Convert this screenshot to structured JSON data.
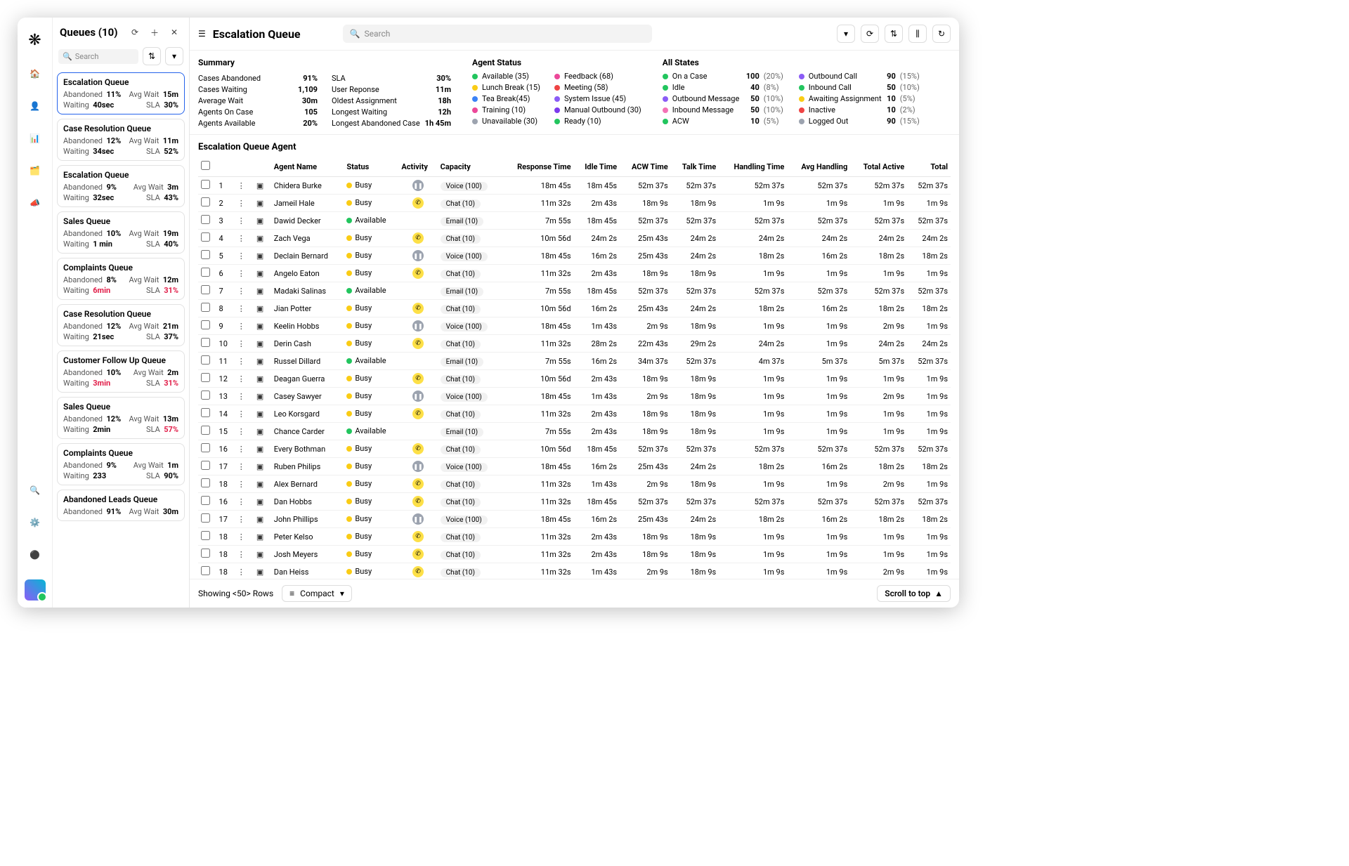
{
  "sidebar": {
    "title": "Queues (10)",
    "search_placeholder": "Search",
    "queues": [
      {
        "title": "Escalation Queue",
        "abandoned": "11%",
        "avgwait": "15m",
        "waiting": "40sec",
        "sla": "30%",
        "active": true
      },
      {
        "title": "Case Resolution Queue",
        "abandoned": "12%",
        "avgwait": "11m",
        "waiting": "34sec",
        "sla": "52%"
      },
      {
        "title": "Escalation Queue",
        "abandoned": "9%",
        "avgwait": "3m",
        "waiting": "32sec",
        "sla": "43%"
      },
      {
        "title": "Sales Queue",
        "abandoned": "10%",
        "avgwait": "19m",
        "waiting": "1 min",
        "sla": "40%"
      },
      {
        "title": "Complaints Queue",
        "abandoned": "8%",
        "avgwait": "12m",
        "waiting": "6min",
        "waiting_red": true,
        "sla": "31%",
        "sla_red": true
      },
      {
        "title": "Case Resolution Queue",
        "abandoned": "12%",
        "avgwait": "21m",
        "waiting": "21sec",
        "sla": "37%"
      },
      {
        "title": "Customer Follow Up Queue",
        "abandoned": "10%",
        "avgwait": "2m",
        "waiting": "3min",
        "waiting_red": true,
        "sla": "31%",
        "sla_red": true
      },
      {
        "title": "Sales Queue",
        "abandoned": "12%",
        "avgwait": "13m",
        "waiting": "2min",
        "sla": "57%",
        "sla_red": true
      },
      {
        "title": "Complaints Queue",
        "abandoned": "9%",
        "avgwait": "1m",
        "waiting": "233",
        "sla": "90%"
      },
      {
        "title": "Abandoned Leads Queue",
        "abandoned": "91%",
        "avgwait": "30m"
      }
    ]
  },
  "header": {
    "page_title": "Escalation Queue",
    "search_placeholder": "Search"
  },
  "summary": {
    "title": "Summary",
    "left": [
      {
        "l": "Cases Abandoned",
        "v": "91%"
      },
      {
        "l": "Cases Waiting",
        "v": "1,109"
      },
      {
        "l": "Average Wait",
        "v": "30m"
      },
      {
        "l": "Agents On Case",
        "v": "105"
      },
      {
        "l": "Agents Available",
        "v": "20%"
      }
    ],
    "right": [
      {
        "l": "SLA",
        "v": "30%"
      },
      {
        "l": "User Reponse",
        "v": "11m"
      },
      {
        "l": "Oldest Assignment",
        "v": "18h"
      },
      {
        "l": "Longest Waiting",
        "v": "12h"
      },
      {
        "l": "Longest Abandoned Case",
        "v": "1h 45m"
      }
    ]
  },
  "agent_status": {
    "title": "Agent Status",
    "col1": [
      {
        "c": "#22c55e",
        "t": "Available (35)"
      },
      {
        "c": "#facc15",
        "t": "Lunch Break (15)"
      },
      {
        "c": "#3b82f6",
        "t": "Tea Break(45)"
      },
      {
        "c": "#ec4899",
        "t": "Training (10)"
      },
      {
        "c": "#9ca3af",
        "t": "Unavailable (30)"
      }
    ],
    "col2": [
      {
        "c": "#ec4899",
        "t": "Feedback (68)"
      },
      {
        "c": "#ef4444",
        "t": "Meeting (58)"
      },
      {
        "c": "#8b5cf6",
        "t": "System Issue (45)"
      },
      {
        "c": "#7c3aed",
        "t": "Manual Outbound (30)"
      },
      {
        "c": "#22c55e",
        "t": "Ready (10)"
      }
    ]
  },
  "all_states": {
    "title": "All States",
    "col1": [
      {
        "c": "#22c55e",
        "t": "On a Case",
        "n": "100",
        "p": "(20%)"
      },
      {
        "c": "#22c55e",
        "t": "Idle",
        "n": "40",
        "p": "(8%)"
      },
      {
        "c": "#8b5cf6",
        "t": "Outbound Message",
        "n": "50",
        "p": "(10%)"
      },
      {
        "c": "#f472b6",
        "t": "Inbound Message",
        "n": "50",
        "p": "(10%)"
      },
      {
        "c": "#22c55e",
        "t": "ACW",
        "n": "10",
        "p": "(5%)"
      }
    ],
    "col2": [
      {
        "c": "#8b5cf6",
        "t": "Outbound Call",
        "n": "90",
        "p": "(15%)"
      },
      {
        "c": "#22c55e",
        "t": "Inbound Call",
        "n": "50",
        "p": "(10%)"
      },
      {
        "c": "#facc15",
        "t": "Awaiting Assignment",
        "n": "10",
        "p": "(5%)"
      },
      {
        "c": "#ef4444",
        "t": "Inactive",
        "n": "10",
        "p": "(2%)"
      },
      {
        "c": "#9ca3af",
        "t": "Logged Out",
        "n": "90",
        "p": "(15%)"
      }
    ]
  },
  "table": {
    "title": "Escalation Queue Agent",
    "headers": [
      "",
      "",
      "",
      "",
      "Agent Name",
      "Status",
      "Activity",
      "Capacity",
      "Response Time",
      "Idle Time",
      "ACW Time",
      "Talk Time",
      "Handling Time",
      "Avg Handling",
      "Total Active",
      "Total"
    ],
    "rows": [
      {
        "n": "1",
        "name": "Chidera Burke",
        "status": "Busy",
        "act": "pause",
        "cap": "Voice (100)",
        "rt": "18m 45s",
        "it": "18m 45s",
        "aw": "52m 37s",
        "tt": "52m 37s",
        "ht": "52m 37s",
        "ah": "52m 37s",
        "ta": "52m 37s",
        "to": "52m 37s"
      },
      {
        "n": "2",
        "name": "Jameil Hale",
        "status": "Busy",
        "act": "call",
        "cap": "Chat (10)",
        "rt": "11m 32s",
        "it": "2m 43s",
        "aw": "18m 9s",
        "tt": "18m 9s",
        "ht": "1m 9s",
        "ah": "1m 9s",
        "ta": "1m 9s",
        "to": "1m 9s"
      },
      {
        "n": "3",
        "name": "Dawid Decker",
        "status": "Available",
        "act": "",
        "cap": "Email (10)",
        "rt": "7m 55s",
        "it": "18m 45s",
        "aw": "52m 37s",
        "tt": "52m 37s",
        "ht": "52m 37s",
        "ah": "52m 37s",
        "ta": "52m 37s",
        "to": "52m 37s"
      },
      {
        "n": "4",
        "name": "Zach Vega",
        "status": "Busy",
        "act": "call",
        "cap": "Chat (10)",
        "rt": "10m 56d",
        "it": "24m 2s",
        "aw": "25m 43s",
        "tt": "24m 2s",
        "ht": "24m 2s",
        "ah": "24m 2s",
        "ta": "24m 2s",
        "to": "24m 2s"
      },
      {
        "n": "5",
        "name": "Declain Bernard",
        "status": "Busy",
        "act": "pause",
        "cap": "Voice (100)",
        "rt": "18m 45s",
        "it": "16m 2s",
        "aw": "25m 43s",
        "tt": "24m 2s",
        "ht": "18m 2s",
        "ah": "16m 2s",
        "ta": "18m 2s",
        "to": "18m 2s"
      },
      {
        "n": "6",
        "name": "Angelo Eaton",
        "status": "Busy",
        "act": "call",
        "cap": "Chat (10)",
        "rt": "11m 32s",
        "it": "2m 43s",
        "aw": "18m 9s",
        "tt": "18m 9s",
        "ht": "1m 9s",
        "ah": "1m 9s",
        "ta": "1m 9s",
        "to": "1m 9s"
      },
      {
        "n": "7",
        "name": "Madaki Salinas",
        "status": "Available",
        "act": "",
        "cap": "Email (10)",
        "rt": "7m 55s",
        "it": "18m 45s",
        "aw": "52m 37s",
        "tt": "52m 37s",
        "ht": "52m 37s",
        "ah": "52m 37s",
        "ta": "52m 37s",
        "to": "52m 37s"
      },
      {
        "n": "8",
        "name": "Jian Potter",
        "status": "Busy",
        "act": "call",
        "cap": "Chat (10)",
        "rt": "10m 56d",
        "it": "16m 2s",
        "aw": "25m 43s",
        "tt": "24m 2s",
        "ht": "18m 2s",
        "ah": "16m 2s",
        "ta": "18m 2s",
        "to": "18m 2s"
      },
      {
        "n": "9",
        "name": "Keelin Hobbs",
        "status": "Busy",
        "act": "pause",
        "cap": "Voice (100)",
        "rt": "18m 45s",
        "it": "1m 43s",
        "aw": "2m 9s",
        "tt": "18m 9s",
        "ht": "1m 9s",
        "ah": "1m 9s",
        "ta": "2m 9s",
        "to": "1m 9s"
      },
      {
        "n": "10",
        "name": "Derin Cash",
        "status": "Busy",
        "act": "call",
        "cap": "Chat (10)",
        "rt": "11m 32s",
        "it": "28m 2s",
        "aw": "22m 43s",
        "tt": "29m 2s",
        "ht": "24m 2s",
        "ah": "1m 9s",
        "ta": "24m 2s",
        "to": "24m 2s"
      },
      {
        "n": "11",
        "name": "Russel Dillard",
        "status": "Available",
        "act": "",
        "cap": "Email (10)",
        "rt": "7m 55s",
        "it": "16m 2s",
        "aw": "34m 37s",
        "tt": "52m 37s",
        "ht": "4m 37s",
        "ah": "5m 37s",
        "ta": "5m 37s",
        "to": "52m 37s"
      },
      {
        "n": "12",
        "name": "Deagan Guerra",
        "status": "Busy",
        "act": "call",
        "cap": "Chat (10)",
        "rt": "10m 56d",
        "it": "2m 43s",
        "aw": "18m 9s",
        "tt": "18m 9s",
        "ht": "1m 9s",
        "ah": "1m 9s",
        "ta": "1m 9s",
        "to": "1m 9s"
      },
      {
        "n": "13",
        "name": "Casey Sawyer",
        "status": "Busy",
        "act": "pause",
        "cap": "Voice (100)",
        "rt": "18m 45s",
        "it": "1m 43s",
        "aw": "2m 9s",
        "tt": "18m 9s",
        "ht": "1m 9s",
        "ah": "1m 9s",
        "ta": "2m 9s",
        "to": "1m 9s"
      },
      {
        "n": "14",
        "name": "Leo Korsgard",
        "status": "Busy",
        "act": "call",
        "cap": "Chat (10)",
        "rt": "11m 32s",
        "it": "2m 43s",
        "aw": "18m 9s",
        "tt": "18m 9s",
        "ht": "1m 9s",
        "ah": "1m 9s",
        "ta": "1m 9s",
        "to": "1m 9s"
      },
      {
        "n": "15",
        "name": "Chance Carder",
        "status": "Available",
        "act": "",
        "cap": "Email (10)",
        "rt": "7m 55s",
        "it": "2m 43s",
        "aw": "18m 9s",
        "tt": "18m 9s",
        "ht": "1m 9s",
        "ah": "1m 9s",
        "ta": "1m 9s",
        "to": "1m 9s"
      },
      {
        "n": "16",
        "name": "Every Bothman",
        "status": "Busy",
        "act": "call",
        "cap": "Chat (10)",
        "rt": "10m 56d",
        "it": "18m 45s",
        "aw": "52m 37s",
        "tt": "52m 37s",
        "ht": "52m 37s",
        "ah": "52m 37s",
        "ta": "52m 37s",
        "to": "52m 37s"
      },
      {
        "n": "17",
        "name": "Ruben Philips",
        "status": "Busy",
        "act": "pause",
        "cap": "Voice (100)",
        "rt": "18m 45s",
        "it": "16m 2s",
        "aw": "25m 43s",
        "tt": "24m 2s",
        "ht": "18m 2s",
        "ah": "16m 2s",
        "ta": "18m 2s",
        "to": "18m 2s"
      },
      {
        "n": "18",
        "name": "Alex Bernard",
        "status": "Busy",
        "act": "call",
        "cap": "Chat (10)",
        "rt": "11m 32s",
        "it": "1m 43s",
        "aw": "2m 9s",
        "tt": "18m 9s",
        "ht": "1m 9s",
        "ah": "1m 9s",
        "ta": "2m 9s",
        "to": "1m 9s"
      },
      {
        "n": "16",
        "name": "Dan Hobbs",
        "status": "Busy",
        "act": "call",
        "cap": "Chat (10)",
        "rt": "11m 32s",
        "it": "18m 45s",
        "aw": "52m 37s",
        "tt": "52m 37s",
        "ht": "52m 37s",
        "ah": "52m 37s",
        "ta": "52m 37s",
        "to": "52m 37s"
      },
      {
        "n": "17",
        "name": "John Phillips",
        "status": "Busy",
        "act": "pause",
        "cap": "Voice (100)",
        "rt": "18m 45s",
        "it": "16m 2s",
        "aw": "25m 43s",
        "tt": "24m 2s",
        "ht": "18m 2s",
        "ah": "16m 2s",
        "ta": "18m 2s",
        "to": "18m 2s"
      },
      {
        "n": "18",
        "name": "Peter Kelso",
        "status": "Busy",
        "act": "call",
        "cap": "Chat (10)",
        "rt": "11m 32s",
        "it": "2m 43s",
        "aw": "18m 9s",
        "tt": "18m 9s",
        "ht": "1m 9s",
        "ah": "1m 9s",
        "ta": "1m 9s",
        "to": "1m 9s"
      },
      {
        "n": "18",
        "name": "Josh Meyers",
        "status": "Busy",
        "act": "call",
        "cap": "Chat (10)",
        "rt": "11m 32s",
        "it": "2m 43s",
        "aw": "18m 9s",
        "tt": "18m 9s",
        "ht": "1m 9s",
        "ah": "1m 9s",
        "ta": "1m 9s",
        "to": "1m 9s"
      },
      {
        "n": "18",
        "name": "Dan Heiss",
        "status": "Busy",
        "act": "call",
        "cap": "Chat (10)",
        "rt": "11m 32s",
        "it": "1m 43s",
        "aw": "2m 9s",
        "tt": "18m 9s",
        "ht": "1m 9s",
        "ah": "1m 9s",
        "ta": "2m 9s",
        "to": "1m 9s"
      }
    ]
  },
  "footer": {
    "showing": "Showing <50> Rows",
    "density": "Compact",
    "scrolltop": "Scroll to top"
  },
  "labels": {
    "abandoned": "Abandoned",
    "avgwait": "Avg Wait",
    "waiting": "Waiting",
    "sla": "SLA"
  }
}
